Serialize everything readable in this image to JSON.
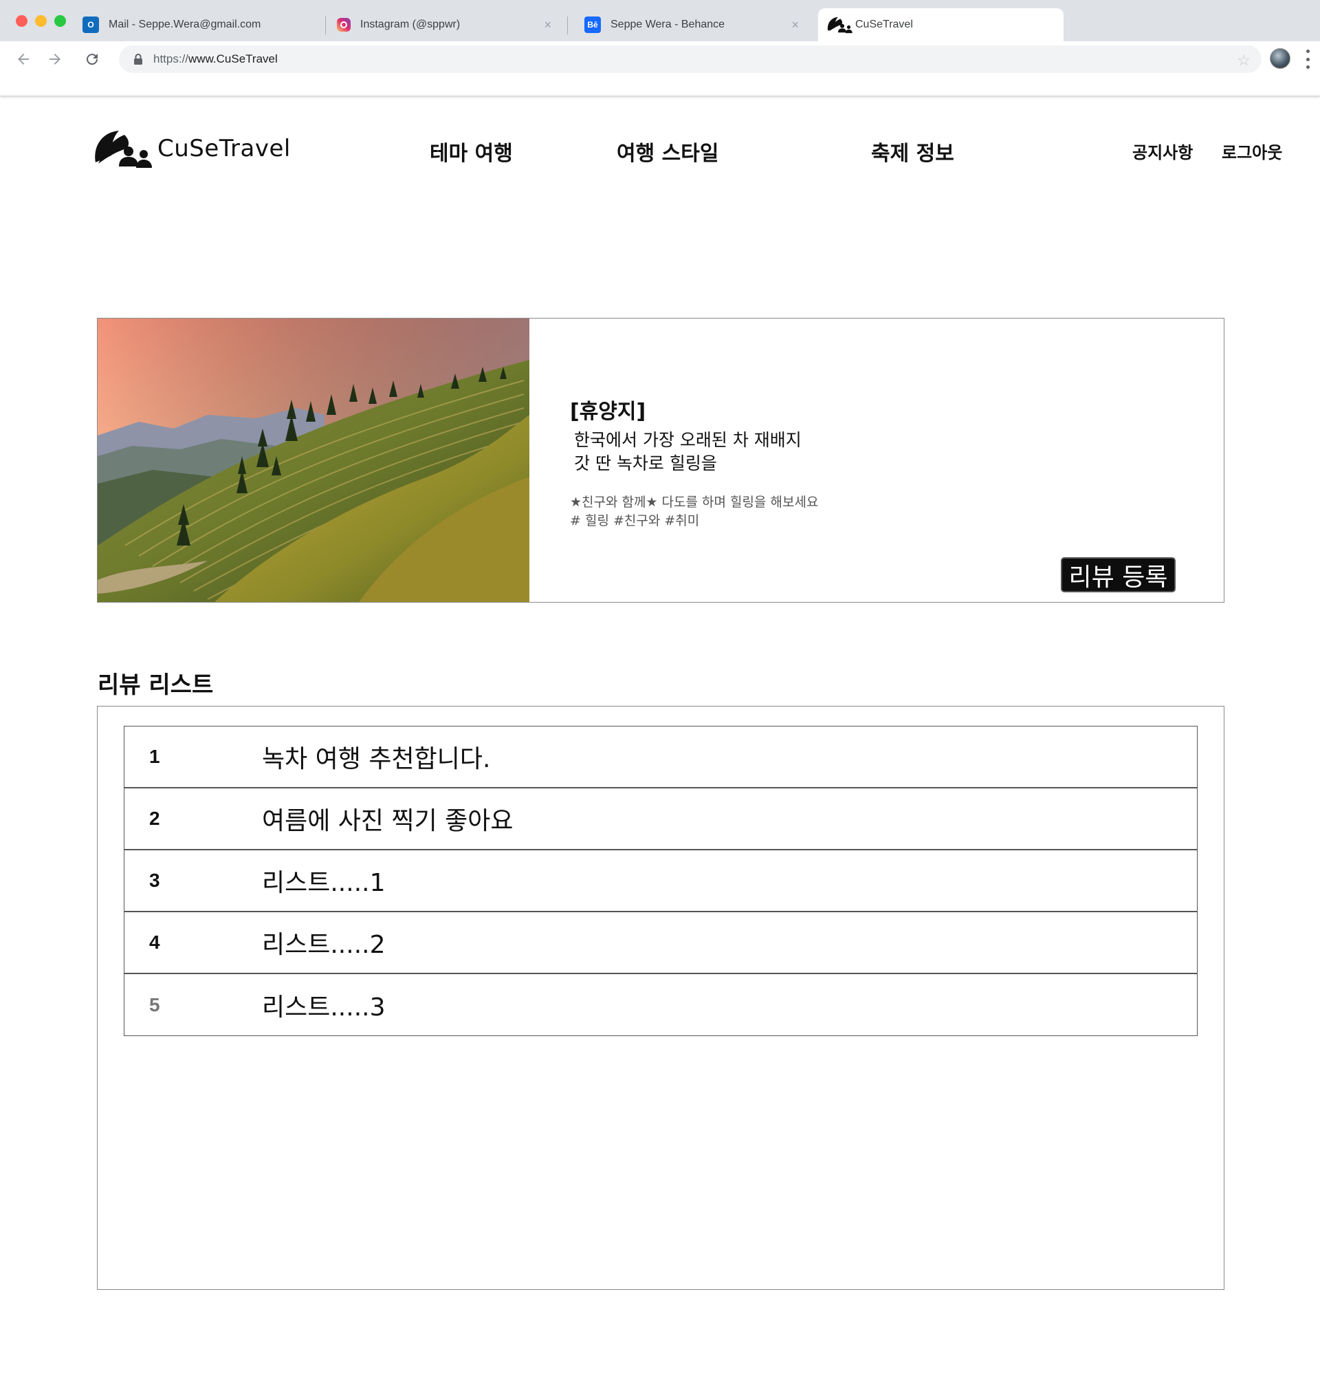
{
  "browser": {
    "tabs": [
      {
        "title": "Mail - Seppe.Wera@gmail.com",
        "favicon": "outlook-icon",
        "color": "#0f6cbd"
      },
      {
        "title": "Instagram (@sppwr)",
        "favicon": "instagram-icon",
        "color": "#e1306c"
      },
      {
        "title": "Seppe Wera - Behance",
        "favicon": "behance-icon",
        "color": "#1769ff"
      },
      {
        "title": "CuSeTravel",
        "favicon": "cusetravel-icon",
        "active": true
      }
    ],
    "url_protocol": "https://",
    "url_host": "www.CuSeTravel"
  },
  "site": {
    "logo_text": "CuSeTravel",
    "nav": {
      "theme": "테마 여행",
      "style": "여행 스타일",
      "festival": "축제 정보",
      "notice": "공지사항",
      "logout": "로그아웃"
    }
  },
  "feature": {
    "category": "[휴양지]",
    "headline_1": "한국에서 가장 오래된 차 재배지",
    "headline_2": "갓 딴 녹차로 힐링을",
    "desc_1": "★친구와 함께★ 다도를 하며 힐링을 해보세요",
    "desc_2": "# 힐링 #친구와 #취미",
    "review_button": "리뷰 등록",
    "image": "green-tea-plantation-photo"
  },
  "reviews": {
    "heading": "리뷰 리스트",
    "rows": [
      {
        "num": "1",
        "title": "녹차 여행 추천합니다."
      },
      {
        "num": "2",
        "title": "여름에 사진 찍기 좋아요"
      },
      {
        "num": "3",
        "title": "리스트.....1"
      },
      {
        "num": "4",
        "title": "리스트.....2"
      },
      {
        "num": "5",
        "title": "리스트.....3"
      }
    ]
  }
}
